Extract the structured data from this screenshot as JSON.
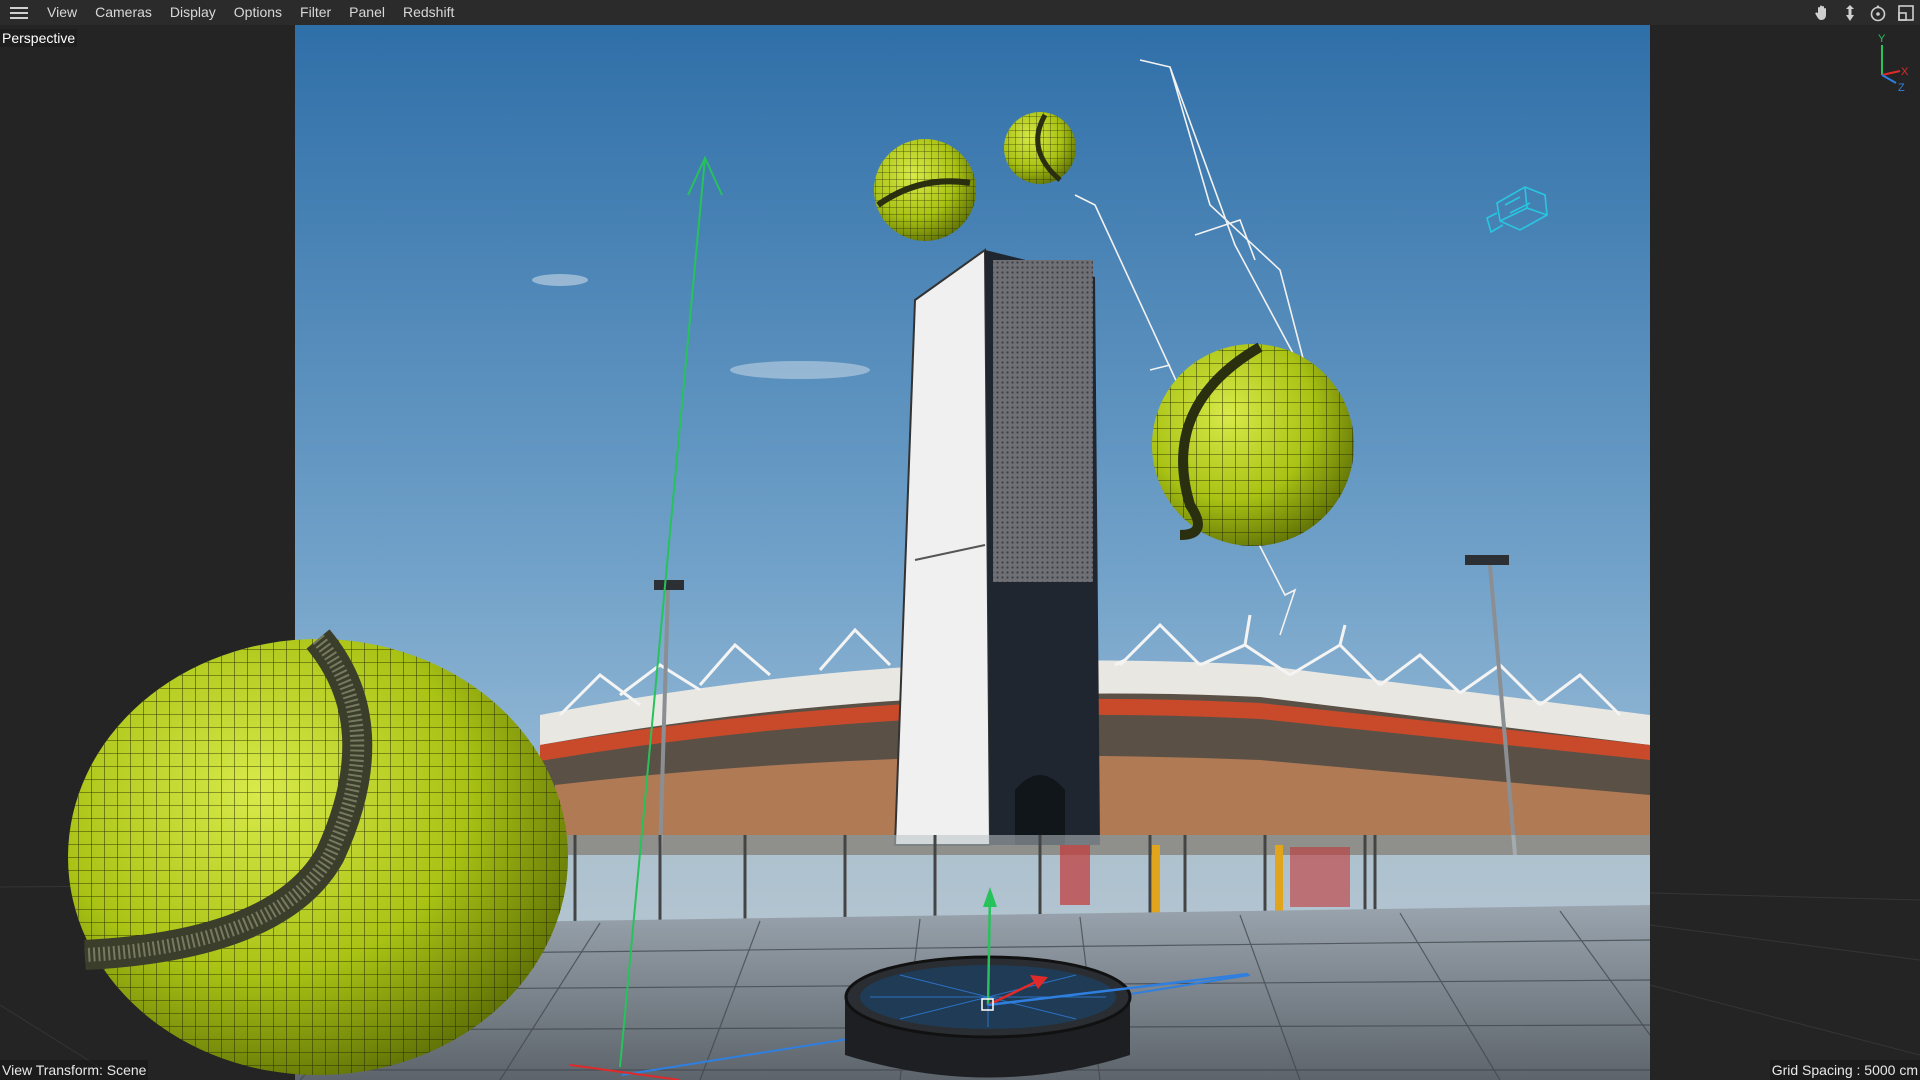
{
  "menubar": {
    "items": [
      "View",
      "Cameras",
      "Display",
      "Options",
      "Filter",
      "Panel",
      "Redshift"
    ],
    "nav_tools": [
      "hand-pan-icon",
      "move-arrow-icon",
      "orbit-icon",
      "maximize-view-icon"
    ]
  },
  "viewport": {
    "camera_label": "Perspective",
    "view_transform": "View Transform: Scene",
    "grid_spacing": "Grid Spacing : 5000 cm"
  },
  "axis_gizmo": {
    "y": "Y",
    "x": "X",
    "z": "Z"
  },
  "colors": {
    "menubar_bg": "#2b2b2b",
    "viewport_bg": "#242424",
    "sky_top": "#2f6fa8",
    "sky_bottom": "#bcd3e3",
    "tennis_ball": "#b8d41e",
    "wireframe": "#1e2200",
    "camera_object": "#29c6e0",
    "axis_y": "#27c25c",
    "axis_x": "#e02a2a",
    "axis_z": "#2f7fe0"
  }
}
